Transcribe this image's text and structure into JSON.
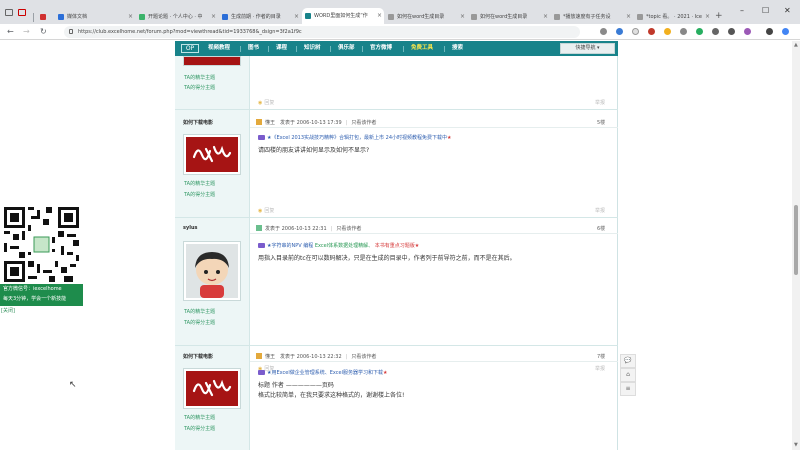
{
  "browser": {
    "tabs": [
      {
        "label": "视频"
      },
      {
        "label": "媒体文档"
      },
      {
        "label": "开题论题 · 个人中心 · 中"
      },
      {
        "label": "生成前期 · 作者的目录"
      },
      {
        "label": "WORD里面如何生成“作"
      },
      {
        "label": "如何在word生成目录"
      },
      {
        "label": "如何在word生成目录"
      },
      {
        "label": "*播放速度有子任务设"
      },
      {
        "label": "*topic 看。 · 2021 · Ice"
      }
    ],
    "url": "https://club.excelhome.net/forum.php?mod=viewthread&tid=1933768&_dsign=3f2a1f9c"
  },
  "nav": {
    "logo": "OP",
    "items": [
      "视频教程",
      "图书",
      "课程",
      "知识树",
      "俱乐部",
      "官方微博",
      "免费工具",
      "搜索"
    ],
    "quick_nav": "快捷导航 ▾"
  },
  "posts": {
    "top": {
      "links": [
        "TA的精华主题",
        "TA的得分主题"
      ],
      "reply": "回复",
      "report": "举报"
    },
    "p1": {
      "author": "如何下载电影",
      "links": [
        "TA的精华主题",
        "TA的得分主题"
      ],
      "user": "懂王",
      "date": "发表于 2006-10-13 17:39",
      "only": "只看该作者",
      "floor": "5楼",
      "ad_a": "★《Excel 2013实战技巧精粹》合辑打包，最新上市 24小时视频教程免费下载中",
      "ad_star": "★",
      "body": "请四楼的朋友讲讲如何显示及如何不显示?",
      "reply": "回复",
      "report": "举报"
    },
    "p2": {
      "author": "sylus",
      "links": [
        "TA的精华主题",
        "TA的得分主题"
      ],
      "user": "",
      "date": "发表于 2006-10-13 22:31",
      "only": "只看该作者",
      "floor": "6楼",
      "ad_a": "★字符串的NPV 编程",
      "ad_b": "Excel体系数据处理精解、",
      "ad_c": "本书有重点习题版",
      "ad_star": "★",
      "body": "用指入目录前的tc在可以数码解决，只是在生成的目录中，作者列于前导符之前，而不是在其后。",
      "reply": "回复",
      "report": "举报"
    },
    "p3": {
      "author": "如何下载电影",
      "links": [
        "TA的精华主题",
        "TA的得分主题"
      ],
      "user": "懂王",
      "date": "发表于 2006-10-13 22:32",
      "only": "只看该作者",
      "floor": "7楼",
      "ad_a": "★用Excel做企业管理系统、Excel服务器学习和下载",
      "ad_star": "★",
      "body1": "标题    作者 ——————页码",
      "body2": "格式比较简单，在我只要求这种格式的，谢谢楼上各位!"
    }
  },
  "floating": {
    "qr_line1": "官方微信号：iexcelhome",
    "qr_line2": "每天3分钟，学会一个新技能",
    "qr_close": "[关闭]",
    "tools": [
      "💬",
      "⌂",
      "≡"
    ]
  }
}
